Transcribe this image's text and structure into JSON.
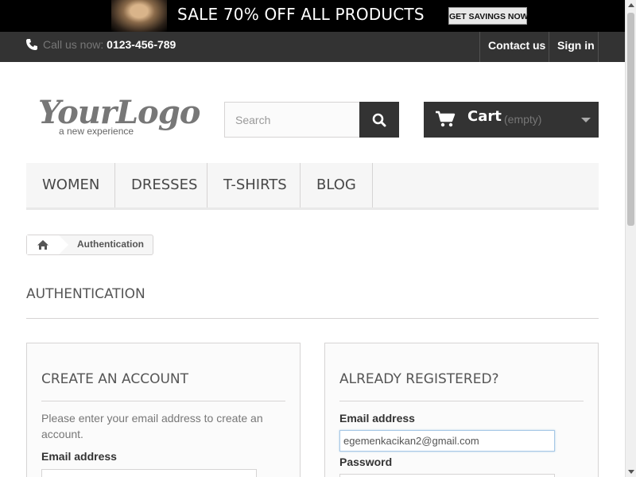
{
  "banner": {
    "sale_text": "SALE 70% OFF ALL PRODUCTS",
    "cta_label": "GET SAVINGS NOW"
  },
  "topnav": {
    "phone_prefix": "Call us now:",
    "phone_number": "0123-456-789",
    "contact_label": "Contact us",
    "signin_label": "Sign in"
  },
  "header": {
    "logo_text": "YourLogo",
    "logo_tagline": "a new experience",
    "search_placeholder": "Search",
    "cart_label": "Cart",
    "cart_status": "(empty)"
  },
  "menu": {
    "items": [
      {
        "label": "WOMEN"
      },
      {
        "label": "DRESSES"
      },
      {
        "label": "T-SHIRTS"
      },
      {
        "label": "BLOG"
      }
    ]
  },
  "breadcrumb": {
    "current": "Authentication"
  },
  "page": {
    "heading": "AUTHENTICATION"
  },
  "create_account": {
    "title": "CREATE AN ACCOUNT",
    "description": "Please enter your email address to create an account.",
    "email_label": "Email address",
    "email_value": ""
  },
  "login": {
    "title": "ALREADY REGISTERED?",
    "email_label": "Email address",
    "email_value": "egemenkacikan2@gmail.com",
    "password_label": "Password"
  },
  "colors": {
    "topnav_bg": "#333333",
    "menu_bg": "#f6f6f6",
    "cart_bg": "#333333"
  }
}
